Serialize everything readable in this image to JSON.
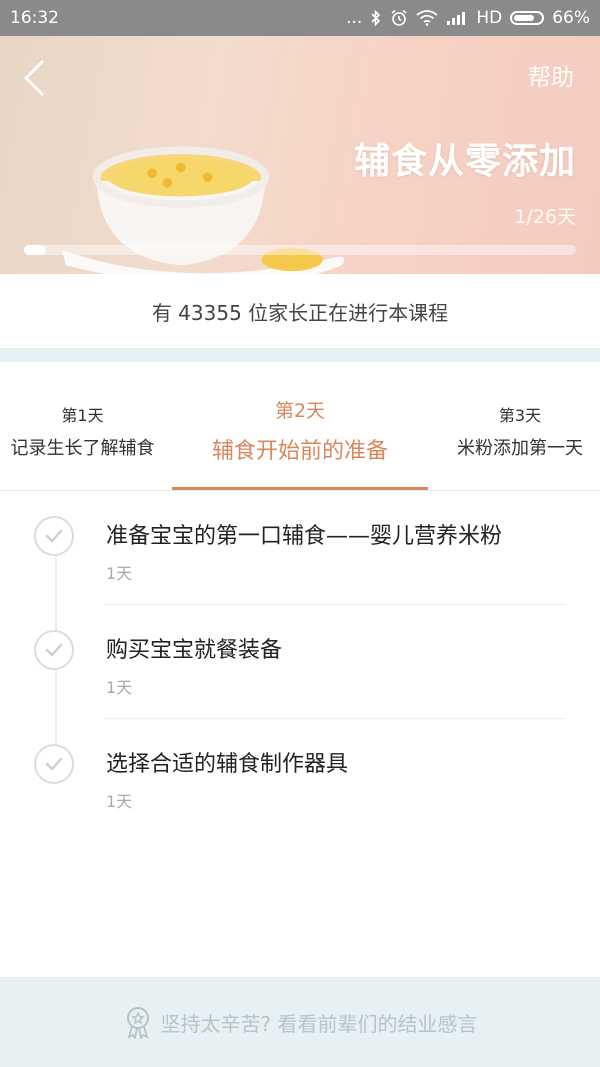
{
  "status_bar": {
    "time": "16:32",
    "dots": "...",
    "network": "HD",
    "battery": "66%",
    "icons": [
      "bluetooth-icon",
      "alarm-icon",
      "wifi-icon",
      "signal-icon",
      "battery-icon"
    ]
  },
  "hero": {
    "help": "帮助",
    "title": "辅食从零添加",
    "day_progress": "1/26天",
    "progress_fraction": 0.04
  },
  "participants_text": "有 43355 位家长正在进行本课程",
  "tabs": [
    {
      "day": "第1天",
      "title": "记录生长了解辅食",
      "active": false
    },
    {
      "day": "第2天",
      "title": "辅食开始前的准备",
      "active": true
    },
    {
      "day": "第3天",
      "title": "米粉添加第一天",
      "active": false
    }
  ],
  "lessons": [
    {
      "title": "准备宝宝的第一口辅食——婴儿营养米粉",
      "duration": "1天"
    },
    {
      "title": "购买宝宝就餐装备",
      "duration": "1天"
    },
    {
      "title": "选择合适的辅食制作器具",
      "duration": "1天"
    }
  ],
  "bottom_link": "坚持太辛苦? 看看前辈们的结业感言",
  "colors": {
    "accent": "#d8875d",
    "status_bar": "#8a8a8a",
    "separator": "#e6f1f4",
    "bottom_bar": "#e7f1f4"
  }
}
